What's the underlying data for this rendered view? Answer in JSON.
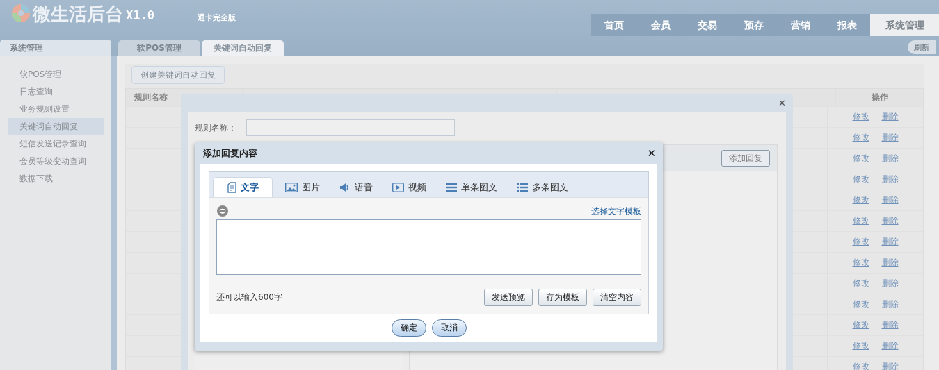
{
  "header": {
    "title": "微生活后台",
    "version": "X1.0",
    "subtitle": "通卡完全版",
    "nav": [
      {
        "label": "首页",
        "selected": false
      },
      {
        "label": "会员",
        "selected": false
      },
      {
        "label": "交易",
        "selected": false
      },
      {
        "label": "预存",
        "selected": false
      },
      {
        "label": "营销",
        "selected": false
      },
      {
        "label": "报表",
        "selected": false
      },
      {
        "label": "系统管理",
        "selected": true
      }
    ]
  },
  "sidebar": {
    "title": "系统管理",
    "items": [
      {
        "label": "软POS管理",
        "selected": false
      },
      {
        "label": "日志查询",
        "selected": false
      },
      {
        "label": "业务规则设置",
        "selected": false
      },
      {
        "label": "关键词自动回复",
        "selected": true
      },
      {
        "label": "短信发送记录查询",
        "selected": false
      },
      {
        "label": "会员等级变动查询",
        "selected": false
      },
      {
        "label": "数据下载",
        "selected": false
      }
    ]
  },
  "tabs": [
    {
      "label": "软POS管理",
      "selected": false
    },
    {
      "label": "关键词自动回复",
      "selected": true
    }
  ],
  "refresh_button": "刷新",
  "create_button": "创建关键词自动回复",
  "table": {
    "columns": [
      "规则名称",
      "操作"
    ],
    "rows": [
      {
        "actions": [
          "修改",
          "删除"
        ]
      },
      {
        "actions": [
          "修改",
          "删除"
        ]
      },
      {
        "actions": [
          "修改",
          "删除"
        ]
      },
      {
        "actions": [
          "修改",
          "删除"
        ]
      },
      {
        "actions": [
          "修改",
          "删除"
        ]
      },
      {
        "actions": [
          "修改",
          "删除"
        ]
      },
      {
        "actions": [
          "修改",
          "删除"
        ]
      },
      {
        "actions": [
          "修改",
          "删除"
        ]
      },
      {
        "actions": [
          "修改",
          "删除"
        ]
      },
      {
        "actions": [
          "修改",
          "删除"
        ]
      },
      {
        "actions": [
          "修改",
          "删除"
        ]
      },
      {
        "actions": [
          "修改",
          "删除"
        ]
      },
      {
        "actions": [
          "修改",
          "删除"
        ]
      }
    ]
  },
  "rule_dialog": {
    "close": "✕",
    "name_label": "规则名称：",
    "add_reply_button": "添加回复"
  },
  "reply_dialog": {
    "title": "添加回复内容",
    "close": "✕",
    "tabs": [
      {
        "label": "文字",
        "kind": "text",
        "selected": true
      },
      {
        "label": "图片",
        "kind": "image",
        "selected": false
      },
      {
        "label": "语音",
        "kind": "voice",
        "selected": false
      },
      {
        "label": "视频",
        "kind": "video",
        "selected": false
      },
      {
        "label": "单条图文",
        "kind": "single",
        "selected": false
      },
      {
        "label": "多条图文",
        "kind": "multi",
        "selected": false
      }
    ],
    "template_link": "选择文字模板",
    "counter": "还可以输入600字",
    "buttons": [
      "发送预览",
      "存为模板",
      "清空内容"
    ],
    "confirm": "确定",
    "cancel": "取消"
  }
}
